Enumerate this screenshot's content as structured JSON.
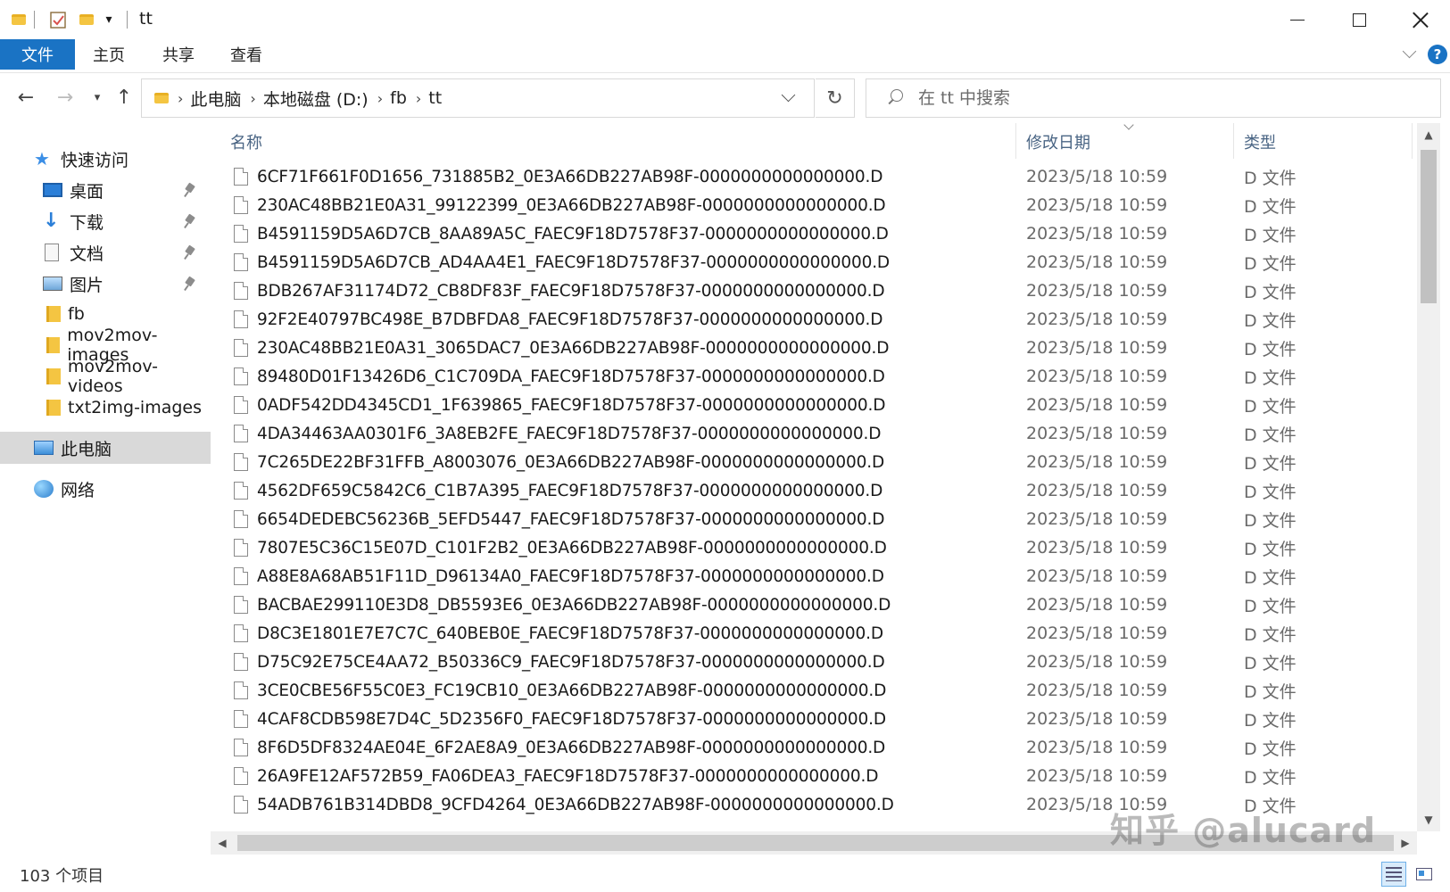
{
  "window": {
    "title": "tt",
    "controls": {
      "minimize": "minimize",
      "maximize": "maximize",
      "close": "close"
    }
  },
  "ribbon": {
    "tabs": [
      {
        "label": "文件",
        "active": true
      },
      {
        "label": "主页"
      },
      {
        "label": "共享"
      },
      {
        "label": "查看"
      }
    ],
    "help": "?"
  },
  "nav": {
    "breadcrumb": [
      "此电脑",
      "本地磁盘 (D:)",
      "fb",
      "tt"
    ],
    "search_placeholder": "在 tt 中搜索"
  },
  "sidebar": {
    "items": [
      {
        "label": "快速访问",
        "icon": "star-icon",
        "pinned": false
      },
      {
        "label": "桌面",
        "icon": "desktop-icon",
        "pinned": true
      },
      {
        "label": "下载",
        "icon": "download-icon",
        "pinned": true
      },
      {
        "label": "文档",
        "icon": "document-icon",
        "pinned": true
      },
      {
        "label": "图片",
        "icon": "pictures-icon",
        "pinned": true
      },
      {
        "label": "fb",
        "icon": "folder-icon",
        "pinned": false
      },
      {
        "label": "mov2mov-images",
        "icon": "folder-icon",
        "pinned": false
      },
      {
        "label": "mov2mov-videos",
        "icon": "folder-icon",
        "pinned": false
      },
      {
        "label": "txt2img-images",
        "icon": "folder-icon",
        "pinned": false
      },
      {
        "label": "此电脑",
        "icon": "this-pc-icon",
        "pinned": false,
        "selected": true
      },
      {
        "label": "网络",
        "icon": "network-icon",
        "pinned": false
      }
    ]
  },
  "list": {
    "columns": {
      "name": "名称",
      "date": "修改日期",
      "type": "类型"
    },
    "rows": [
      {
        "name": "6CF71F661F0D1656_731885B2_0E3A66DB227AB98F-0000000000000000.D",
        "date": "2023/5/18 10:59",
        "type": "D 文件"
      },
      {
        "name": "230AC48BB21E0A31_99122399_0E3A66DB227AB98F-0000000000000000.D",
        "date": "2023/5/18 10:59",
        "type": "D 文件"
      },
      {
        "name": "B4591159D5A6D7CB_8AA89A5C_FAEC9F18D7578F37-0000000000000000.D",
        "date": "2023/5/18 10:59",
        "type": "D 文件"
      },
      {
        "name": "B4591159D5A6D7CB_AD4AA4E1_FAEC9F18D7578F37-0000000000000000.D",
        "date": "2023/5/18 10:59",
        "type": "D 文件"
      },
      {
        "name": "BDB267AF31174D72_CB8DF83F_FAEC9F18D7578F37-0000000000000000.D",
        "date": "2023/5/18 10:59",
        "type": "D 文件"
      },
      {
        "name": "92F2E40797BC498E_B7DBFDA8_FAEC9F18D7578F37-0000000000000000.D",
        "date": "2023/5/18 10:59",
        "type": "D 文件"
      },
      {
        "name": "230AC48BB21E0A31_3065DAC7_0E3A66DB227AB98F-0000000000000000.D",
        "date": "2023/5/18 10:59",
        "type": "D 文件"
      },
      {
        "name": "89480D01F13426D6_C1C709DA_FAEC9F18D7578F37-0000000000000000.D",
        "date": "2023/5/18 10:59",
        "type": "D 文件"
      },
      {
        "name": "0ADF542DD4345CD1_1F639865_FAEC9F18D7578F37-0000000000000000.D",
        "date": "2023/5/18 10:59",
        "type": "D 文件"
      },
      {
        "name": "4DA34463AA0301F6_3A8EB2FE_FAEC9F18D7578F37-0000000000000000.D",
        "date": "2023/5/18 10:59",
        "type": "D 文件"
      },
      {
        "name": "7C265DE22BF31FFB_A8003076_0E3A66DB227AB98F-0000000000000000.D",
        "date": "2023/5/18 10:59",
        "type": "D 文件"
      },
      {
        "name": "4562DF659C5842C6_C1B7A395_FAEC9F18D7578F37-0000000000000000.D",
        "date": "2023/5/18 10:59",
        "type": "D 文件"
      },
      {
        "name": "6654DEDEBC56236B_5EFD5447_FAEC9F18D7578F37-0000000000000000.D",
        "date": "2023/5/18 10:59",
        "type": "D 文件"
      },
      {
        "name": "7807E5C36C15E07D_C101F2B2_0E3A66DB227AB98F-0000000000000000.D",
        "date": "2023/5/18 10:59",
        "type": "D 文件"
      },
      {
        "name": "A88E8A68AB51F11D_D96134A0_FAEC9F18D7578F37-0000000000000000.D",
        "date": "2023/5/18 10:59",
        "type": "D 文件"
      },
      {
        "name": "BACBAE299110E3D8_DB5593E6_0E3A66DB227AB98F-0000000000000000.D",
        "date": "2023/5/18 10:59",
        "type": "D 文件"
      },
      {
        "name": "D8C3E1801E7E7C7C_640BEB0E_FAEC9F18D7578F37-0000000000000000.D",
        "date": "2023/5/18 10:59",
        "type": "D 文件"
      },
      {
        "name": "D75C92E75CE4AA72_B50336C9_FAEC9F18D7578F37-0000000000000000.D",
        "date": "2023/5/18 10:59",
        "type": "D 文件"
      },
      {
        "name": "3CE0CBE56F55C0E3_FC19CB10_0E3A66DB227AB98F-0000000000000000.D",
        "date": "2023/5/18 10:59",
        "type": "D 文件"
      },
      {
        "name": "4CAF8CDB598E7D4C_5D2356F0_FAEC9F18D7578F37-0000000000000000.D",
        "date": "2023/5/18 10:59",
        "type": "D 文件"
      },
      {
        "name": "8F6D5DF8324AE04E_6F2AE8A9_0E3A66DB227AB98F-0000000000000000.D",
        "date": "2023/5/18 10:59",
        "type": "D 文件"
      },
      {
        "name": "26A9FE12AF572B59_FA06DEA3_FAEC9F18D7578F37-0000000000000000.D",
        "date": "2023/5/18 10:59",
        "type": "D 文件"
      },
      {
        "name": "54ADB761B314DBD8_9CFD4264_0E3A66DB227AB98F-0000000000000000.D",
        "date": "2023/5/18 10:59",
        "type": "D 文件"
      }
    ]
  },
  "status": {
    "item_count": "103 个项目"
  },
  "watermark": "知乎 @alucard"
}
